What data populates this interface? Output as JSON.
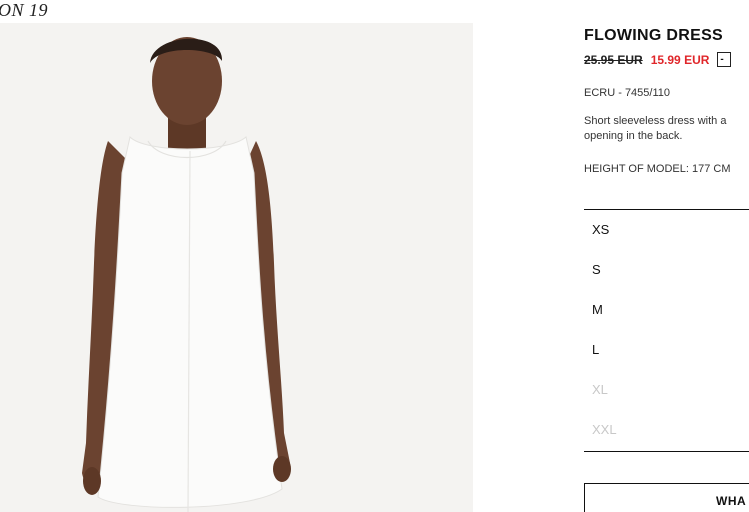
{
  "season_label": "ON 19",
  "product": {
    "image_alt": "Model wearing white sleeveless flowing dress",
    "title": "FLOWING DRESS",
    "old_price": "25.95 EUR",
    "new_price": "15.99 EUR",
    "discount_badge": "-",
    "reference": "ECRU - 7455/110",
    "description": "Short sleeveless dress with a opening in the back.",
    "model_height": "HEIGHT OF MODEL: 177 CM"
  },
  "sizes": [
    {
      "label": "XS",
      "available": true
    },
    {
      "label": "S",
      "available": true
    },
    {
      "label": "M",
      "available": true
    },
    {
      "label": "L",
      "available": true
    },
    {
      "label": "XL",
      "available": false
    },
    {
      "label": "XXL",
      "available": false
    }
  ],
  "cta": {
    "label": "WHA"
  },
  "colors": {
    "sale_price": "#e0262a",
    "unavailable_size": "#c8c8c8",
    "image_background": "#f4f3f1"
  }
}
